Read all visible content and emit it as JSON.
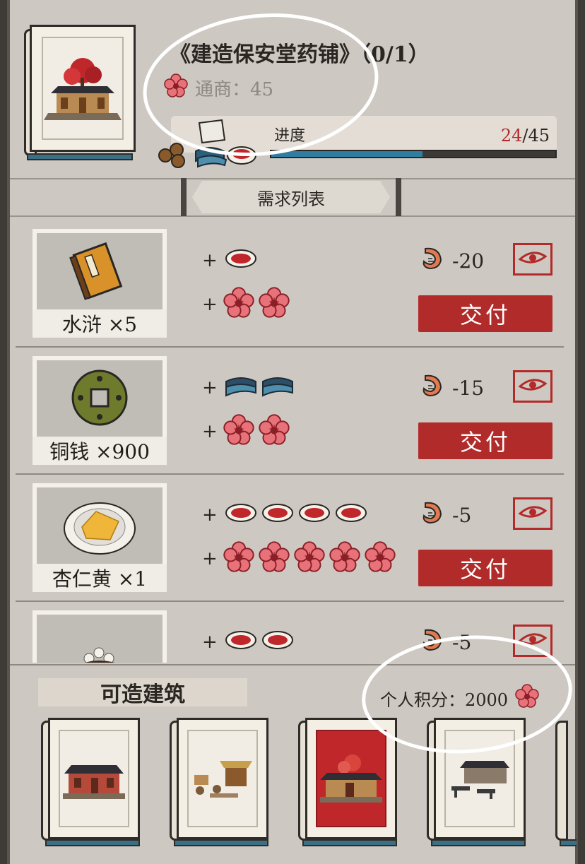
{
  "header": {
    "title": "《建造保安堂药铺》（0/1）",
    "trade_label": "通商：45",
    "progress_label": "进度",
    "progress_current": "24",
    "progress_total": "/45",
    "progress_fraction": 0.533
  },
  "requirements_header": "需求列表",
  "plus_sign": "+",
  "deliver_label": "交付",
  "items": [
    {
      "name": "水浒 ×5",
      "bowls": 1,
      "blossoms": 2,
      "bowl_icon": "red-bowl-icon",
      "cost": "-20"
    },
    {
      "name": "铜钱 ×900",
      "cloths": 2,
      "blossoms": 2,
      "cost": "-15"
    },
    {
      "name": "杏仁黄 ×1",
      "bowls": 4,
      "blossoms": 5,
      "cost": "-5"
    },
    {
      "name": "",
      "bowls": 2,
      "blossoms": 0,
      "cost": "-5"
    }
  ],
  "bottom": {
    "buildable_label": "可造建筑",
    "score_label": "个人积分：2000"
  },
  "colors": {
    "accent_red": "#b22b2b",
    "progress_blue": "#2f7da1",
    "panel_bg": "#cdc8c1"
  }
}
